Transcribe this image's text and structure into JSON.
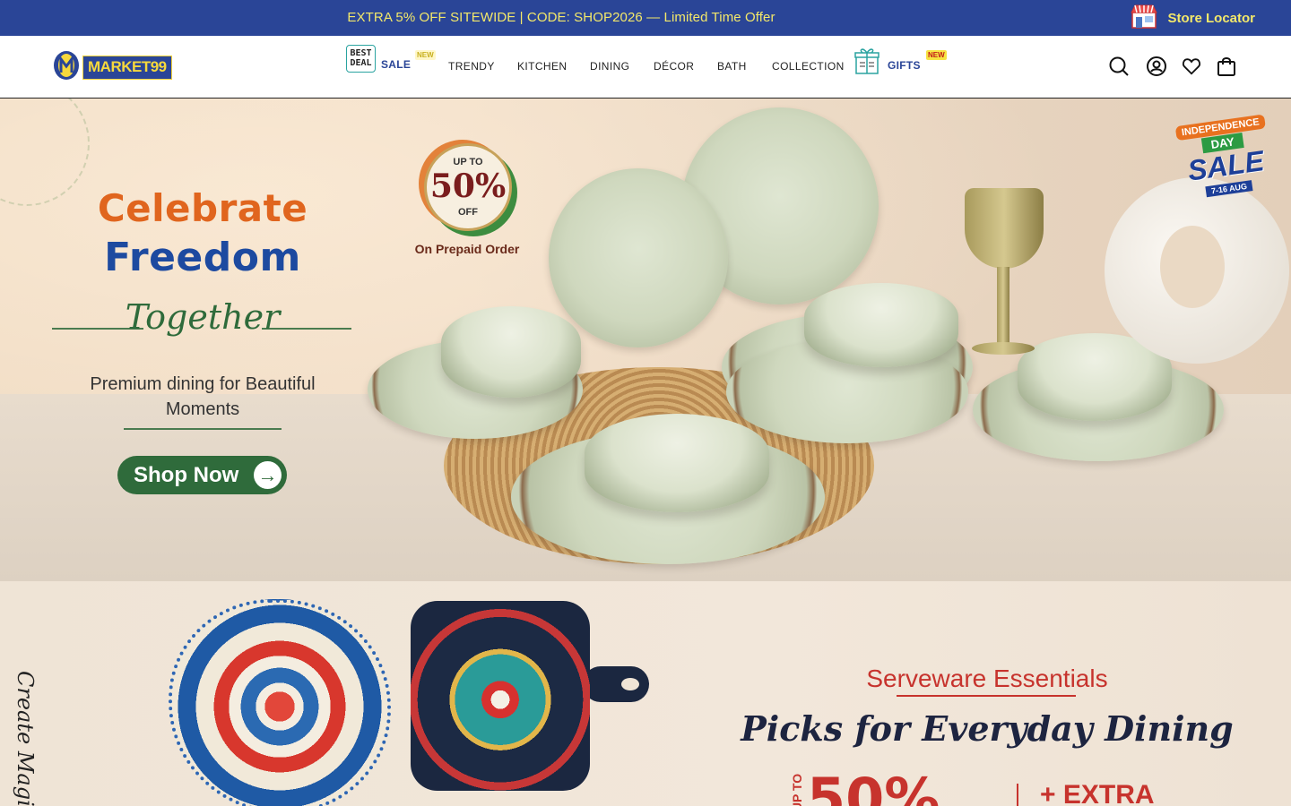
{
  "announcement": {
    "text": "EXTRA 5% OFF SITEWIDE | CODE: SHOP2026 — Limited Time Offer",
    "store_locator": "Store Locator"
  },
  "header": {
    "logo_text": "MARKET99",
    "best_deal_line1": "BEST",
    "best_deal_line2": "DEAL",
    "sale_label": "SALE",
    "sale_badge": "NEW",
    "nav": [
      "TRENDY",
      "KITCHEN",
      "DINING",
      "DÉCOR",
      "BATH",
      "COLLECTION"
    ],
    "gifts_label": "GIFTS",
    "gifts_badge": "NEW",
    "icons": [
      "search-icon",
      "account-icon",
      "wishlist-icon",
      "cart-icon"
    ]
  },
  "hero": {
    "title_line1": "Celebrate",
    "title_line2": "Freedom",
    "script_word": "Together",
    "subtitle": "Premium dining for Beautiful Moments",
    "cta": "Shop Now",
    "promo_upto": "UP TO",
    "promo_percent": "50%",
    "promo_off": "OFF",
    "promo_note": "On Prepaid Order",
    "sale_tag_line1": "INDEPENDENCE",
    "sale_tag_line2": "DAY",
    "sale_tag_line3": "SALE",
    "sale_tag_dates": "7-16 AUG",
    "colors": {
      "orange": "#e0651e",
      "blue": "#1d4aa0",
      "green": "#2f6b3b"
    }
  },
  "banner2": {
    "side_text": "Create Magical",
    "kicker": "Serveware Essentials",
    "title": "Picks for Everyday Dining",
    "upto": "UP TO",
    "percent": "50%",
    "extra": "+ EXTRA"
  },
  "theme": {
    "brand_blue": "#2a4597",
    "brand_yellow": "#f3e86a"
  }
}
